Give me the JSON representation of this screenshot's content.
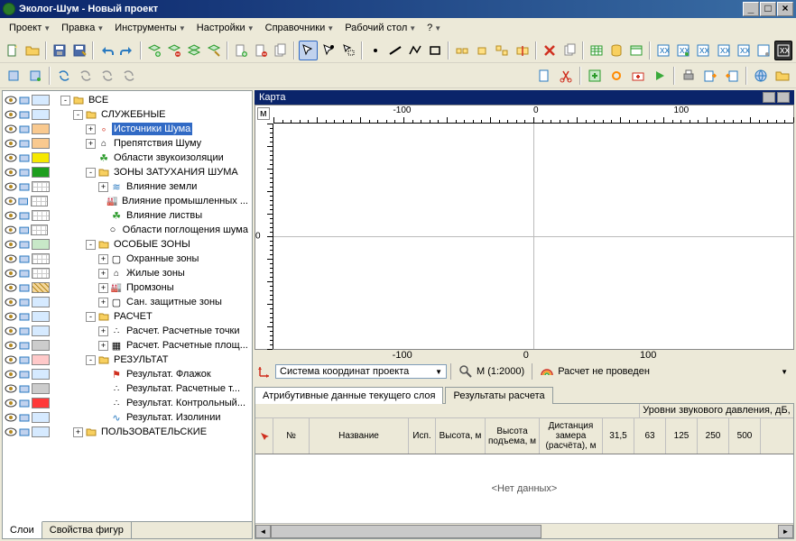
{
  "window": {
    "title": "Эколог-Шум - Новый проект"
  },
  "menu": [
    "Проект",
    "Правка",
    "Инструменты",
    "Настройки",
    "Справочники",
    "Рабочий стол",
    "?"
  ],
  "tree": {
    "tabs": [
      "Слои",
      "Свойства фигур"
    ],
    "items": [
      {
        "lvl": 0,
        "exp": "-",
        "ico": "folder",
        "label": "ВСЕ",
        "sw": "#d6eaff",
        "sel": false
      },
      {
        "lvl": 1,
        "exp": "-",
        "ico": "folder",
        "label": "СЛУЖЕБНЫЕ",
        "sw": "#d6eaff",
        "sel": false
      },
      {
        "lvl": 2,
        "exp": "+",
        "ico": "dot-red",
        "label": "Источники Шума",
        "sw": "#f9c98f",
        "sel": true
      },
      {
        "lvl": 2,
        "exp": "+",
        "ico": "house",
        "label": "Препятствия Шуму",
        "sw": "#f9c98f",
        "sel": false
      },
      {
        "lvl": 2,
        "exp": "",
        "ico": "leaf",
        "label": "Области звукоизоляции",
        "sw": "#f6e800",
        "sel": false
      },
      {
        "lvl": 2,
        "exp": "-",
        "ico": "folder",
        "label": "ЗОНЫ ЗАТУХАНИЯ ШУМА",
        "sw": "#1e9e1e",
        "sel": false
      },
      {
        "lvl": 3,
        "exp": "+",
        "ico": "waves",
        "label": "Влияние земли",
        "sw": "#ffffff",
        "sel": false,
        "grid": true
      },
      {
        "lvl": 3,
        "exp": "",
        "ico": "factory",
        "label": "Влияние промышленных ...",
        "sw": "#ffffff",
        "sel": false,
        "grid": true
      },
      {
        "lvl": 3,
        "exp": "",
        "ico": "leaf",
        "label": "Влияние листвы",
        "sw": "#ffffff",
        "sel": false,
        "grid": true
      },
      {
        "lvl": 3,
        "exp": "",
        "ico": "circle",
        "label": "Области поглощения шума",
        "sw": "#ffffff",
        "sel": false,
        "grid": true
      },
      {
        "lvl": 2,
        "exp": "-",
        "ico": "folder",
        "label": "ОСОБЫЕ ЗОНЫ",
        "sw": "#c8e8c8",
        "sel": false
      },
      {
        "lvl": 3,
        "exp": "+",
        "ico": "shield",
        "label": "Охранные зоны",
        "sw": "#ffffff",
        "sel": false,
        "grid": true
      },
      {
        "lvl": 3,
        "exp": "+",
        "ico": "house",
        "label": "Жилые зоны",
        "sw": "#ffffff",
        "sel": false,
        "grid": true
      },
      {
        "lvl": 3,
        "exp": "+",
        "ico": "factory",
        "label": "Промзоны",
        "sw": "#f4d69a",
        "sel": false,
        "hatch": true
      },
      {
        "lvl": 3,
        "exp": "+",
        "ico": "shield",
        "label": "Сан. защитные зоны",
        "sw": "#d6eaff",
        "sel": false
      },
      {
        "lvl": 2,
        "exp": "-",
        "ico": "folder",
        "label": "РАСЧЕТ",
        "sw": "#d6eaff",
        "sel": false
      },
      {
        "lvl": 3,
        "exp": "+",
        "ico": "points",
        "label": "Расчет. Расчетные точки",
        "sw": "#d6eaff",
        "sel": false
      },
      {
        "lvl": 3,
        "exp": "+",
        "ico": "grid",
        "label": "Расчет. Расчетные площ...",
        "sw": "#cccccc",
        "sel": false
      },
      {
        "lvl": 2,
        "exp": "-",
        "ico": "folder",
        "label": "РЕЗУЛЬТАТ",
        "sw": "#ffc9c9",
        "sel": false
      },
      {
        "lvl": 3,
        "exp": "",
        "ico": "flag",
        "label": "Результат. Флажок",
        "sw": "#d6eaff",
        "sel": false
      },
      {
        "lvl": 3,
        "exp": "",
        "ico": "points",
        "label": "Результат. Расчетные т...",
        "sw": "#cccccc",
        "sel": false
      },
      {
        "lvl": 3,
        "exp": "",
        "ico": "points",
        "label": "Результат. Контрольный...",
        "sw": "#ff3a3a",
        "sel": false
      },
      {
        "lvl": 3,
        "exp": "",
        "ico": "iso",
        "label": "Результат. Изолинии",
        "sw": "#d6eaff",
        "sel": false
      },
      {
        "lvl": 1,
        "exp": "+",
        "ico": "folder",
        "label": "ПОЛЬЗОВАТЕЛЬСКИЕ",
        "sw": "#d6eaff",
        "sel": false
      }
    ]
  },
  "map": {
    "title": "Карта",
    "unit": "м",
    "top_labels": [
      "-100",
      "0",
      "100"
    ],
    "bottom_labels": [
      "-100",
      "0",
      "100"
    ],
    "left_labels": [
      "0"
    ]
  },
  "status": {
    "coord_system": "Система координат проекта",
    "scale": "М (1:2000)",
    "calc_status": "Расчет не проведен"
  },
  "attr": {
    "tabs": [
      "Атрибутивные данные текущего слоя",
      "Результаты расчета"
    ],
    "group_header": "Уровни звукового давления, дБ, ",
    "columns": [
      "№",
      "Название",
      "Исп.",
      "Высота, м",
      "Высота подъема, м",
      "Дистанция замера (расчёта), м",
      "31,5",
      "63",
      "125",
      "250",
      "500"
    ],
    "empty": "<Нет данных>"
  }
}
